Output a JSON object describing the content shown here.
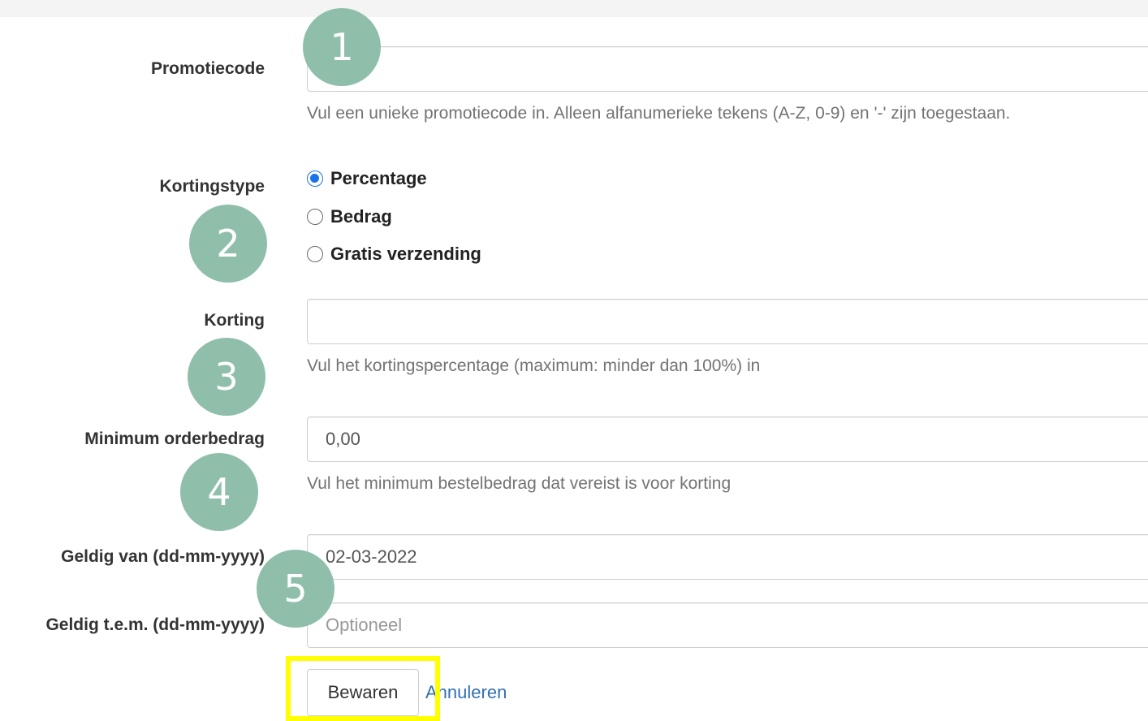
{
  "form": {
    "promo": {
      "label": "Promotiecode",
      "value": "",
      "placeholder": "",
      "help": "Vul een unieke promotiecode in. Alleen alfanumerieke tekens (A-Z, 0-9) en '-' zijn toegestaan."
    },
    "discount_type": {
      "label": "Kortingstype",
      "options": [
        "Percentage",
        "Bedrag",
        "Gratis verzending"
      ],
      "selected": "Percentage"
    },
    "discount": {
      "label": "Korting",
      "value": "",
      "help": "Vul het kortingspercentage (maximum: minder dan 100%) in"
    },
    "min_order": {
      "label": "Minimum orderbedrag",
      "value": "0,00",
      "help": "Vul het minimum bestelbedrag dat vereist is voor korting"
    },
    "valid_from": {
      "label": "Geldig van (dd-mm-yyyy)",
      "value": "02-03-2022"
    },
    "valid_until": {
      "label": "Geldig t.e.m. (dd-mm-yyyy)",
      "value": "",
      "placeholder": "Optioneel"
    },
    "save_label": "Bewaren",
    "cancel_label": "Annuleren"
  },
  "annotations": {
    "badges": [
      "1",
      "2",
      "3",
      "4",
      "5"
    ],
    "badge_color": "#8fbfaa",
    "highlight_color": "#ffff00"
  }
}
